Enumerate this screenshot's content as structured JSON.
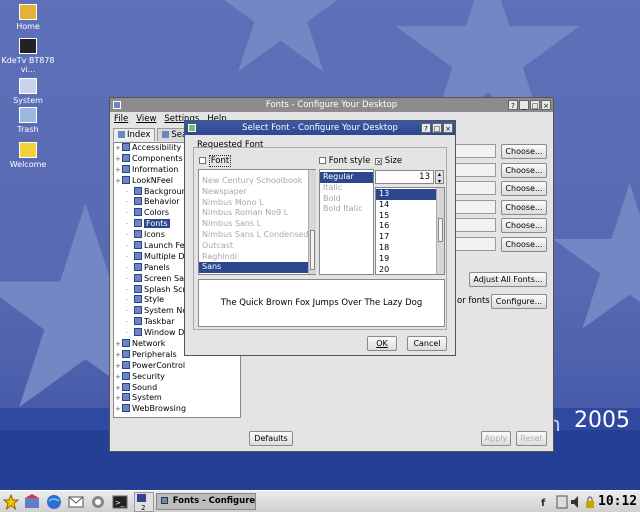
{
  "desktop": {
    "icons": [
      {
        "label": "Home",
        "icon": "home-icon"
      },
      {
        "label": "KdeTv BT878 vi...",
        "icon": "tv-icon"
      },
      {
        "label": "System",
        "icon": "computer-icon"
      },
      {
        "label": "Trash",
        "icon": "trash-icon"
      },
      {
        "label": "Welcome",
        "icon": "star-icon"
      }
    ],
    "brand_partial": "n",
    "brand_year": "2005"
  },
  "fonts_window": {
    "title": "Fonts - Configure Your Desktop",
    "menu": [
      "File",
      "View",
      "Settings",
      "Help"
    ],
    "tabs": [
      "Index",
      "Sea"
    ],
    "tree": [
      {
        "label": "Accessibility",
        "indent": 0
      },
      {
        "label": "Components",
        "indent": 0
      },
      {
        "label": "Information",
        "indent": 0
      },
      {
        "label": "LookNFeel",
        "indent": 0
      },
      {
        "label": "Background",
        "indent": 1
      },
      {
        "label": "Behavior",
        "indent": 1
      },
      {
        "label": "Colors",
        "indent": 1
      },
      {
        "label": "Fonts",
        "indent": 1,
        "selected": true
      },
      {
        "label": "Icons",
        "indent": 1
      },
      {
        "label": "Launch Fe",
        "indent": 1
      },
      {
        "label": "Multiple D",
        "indent": 1
      },
      {
        "label": "Panels",
        "indent": 1
      },
      {
        "label": "Screen Sa",
        "indent": 1
      },
      {
        "label": "Splash Scr",
        "indent": 1
      },
      {
        "label": "Style",
        "indent": 1
      },
      {
        "label": "System No",
        "indent": 1
      },
      {
        "label": "Taskbar",
        "indent": 1
      },
      {
        "label": "Window D",
        "indent": 1
      },
      {
        "label": "Network",
        "indent": 0
      },
      {
        "label": "Peripherals",
        "indent": 0
      },
      {
        "label": "PowerControl",
        "indent": 0
      },
      {
        "label": "Security",
        "indent": 0
      },
      {
        "label": "Sound",
        "indent": 0
      },
      {
        "label": "System",
        "indent": 0
      },
      {
        "label": "WebBrowsing",
        "indent": 0
      }
    ],
    "choose_label": "Choose...",
    "adjust_all_label": "Adjust All Fonts...",
    "or_fonts_text": "or fonts",
    "configure_label": "Configure...",
    "defaults_label": "Defaults",
    "apply_label": "Apply",
    "reset_label": "Reset"
  },
  "select_font": {
    "title": "Select Font - Configure Your Desktop",
    "group_label": "Requested Font",
    "font_check": "Font",
    "style_check": "Font style",
    "size_check": "Size",
    "size_value": "13",
    "fonts": [
      {
        "name": "New Century Schoolbook",
        "disabled": true
      },
      {
        "name": "Newspaper",
        "disabled": true
      },
      {
        "name": "Nimbus Mono L",
        "disabled": true
      },
      {
        "name": "Nimbus Roman No9 L",
        "disabled": true
      },
      {
        "name": "Nimbus Sans L",
        "disabled": true
      },
      {
        "name": "Nimbus Sans L Condensed",
        "disabled": true
      },
      {
        "name": "Outcast",
        "disabled": true
      },
      {
        "name": "Raghindi",
        "disabled": true
      },
      {
        "name": "Sans",
        "selected": true
      }
    ],
    "styles": [
      {
        "name": "Regular",
        "selected": true
      },
      {
        "name": "Italic",
        "disabled": true
      },
      {
        "name": "Bold",
        "disabled": true
      },
      {
        "name": "Bold Italic",
        "disabled": true
      }
    ],
    "sizes": [
      {
        "name": "13",
        "selected": true
      },
      {
        "name": "14"
      },
      {
        "name": "15"
      },
      {
        "name": "16"
      },
      {
        "name": "17"
      },
      {
        "name": "18"
      },
      {
        "name": "19"
      },
      {
        "name": "20"
      }
    ],
    "preview": "The Quick Brown Fox Jumps Over The Lazy Dog",
    "ok_label": "OK",
    "cancel_label": "Cancel"
  },
  "taskbar": {
    "task_label": "Fonts - Configure Y",
    "desktop_num": "2",
    "clock": "10:12"
  }
}
